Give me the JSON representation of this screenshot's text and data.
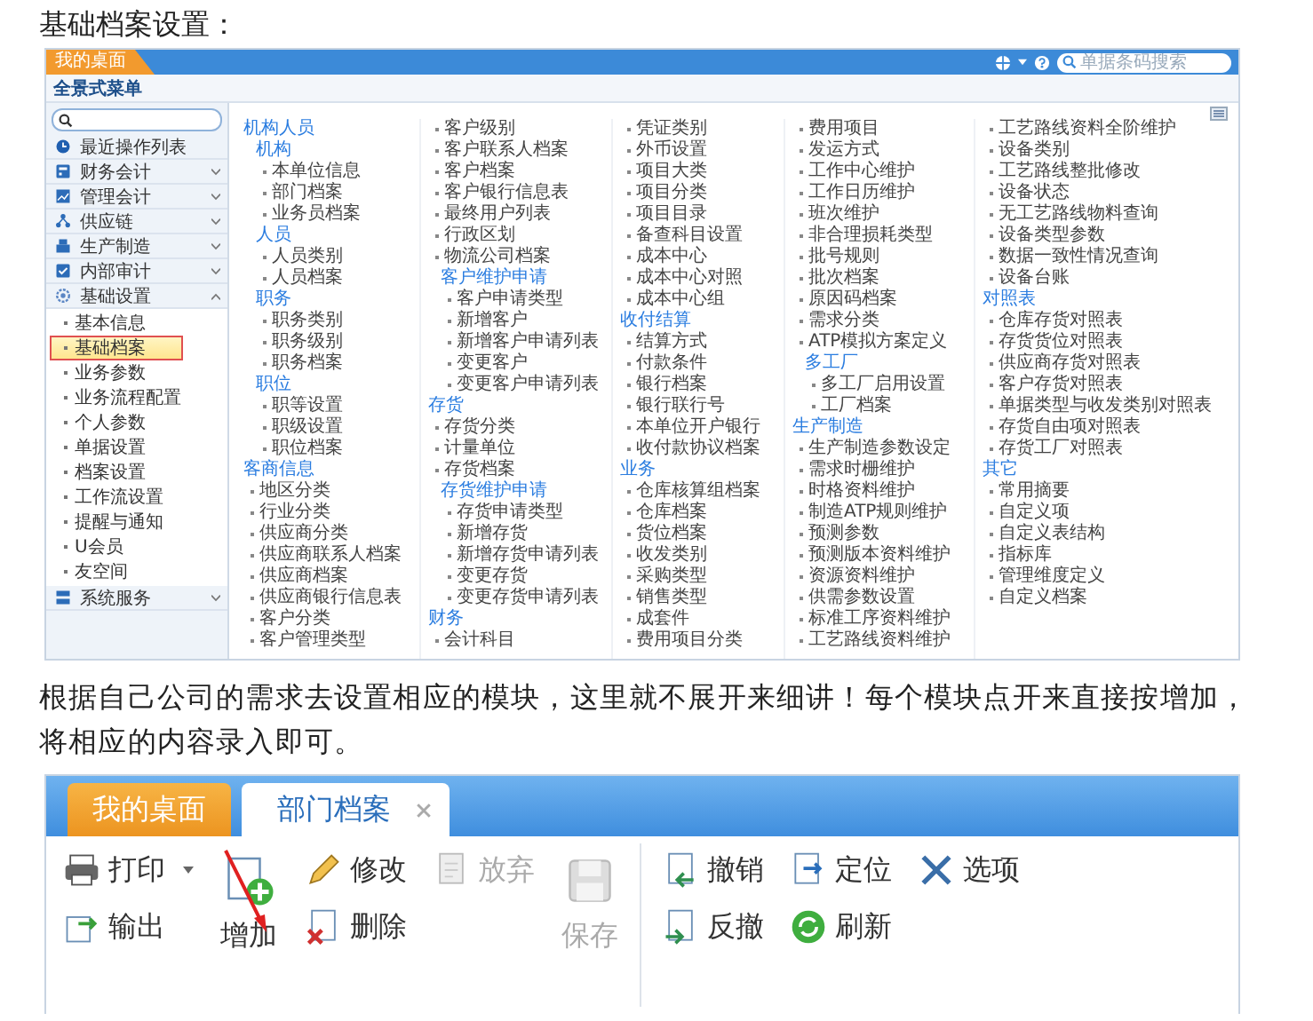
{
  "intro": "基础档案设置：",
  "app1": {
    "tab": "我的桌面",
    "search": {
      "placeholder": "单据条码搜索"
    },
    "menu_title": "全景式菜单",
    "sidebar": [
      {
        "kind": "link",
        "label": "最近操作列表"
      },
      {
        "kind": "category",
        "label": "财务会计",
        "expanded": false
      },
      {
        "kind": "category",
        "label": "管理会计",
        "expanded": false
      },
      {
        "kind": "category",
        "label": "供应链",
        "expanded": false
      },
      {
        "kind": "category",
        "label": "生产制造",
        "expanded": false
      },
      {
        "kind": "category",
        "label": "内部审计",
        "expanded": false
      },
      {
        "kind": "category",
        "label": "基础设置",
        "expanded": true,
        "children": [
          {
            "label": "基本信息",
            "selected": false
          },
          {
            "label": "基础档案",
            "selected": true
          },
          {
            "label": "业务参数",
            "selected": false
          },
          {
            "label": "业务流程配置",
            "selected": false
          },
          {
            "label": "个人参数",
            "selected": false
          },
          {
            "label": "单据设置",
            "selected": false
          },
          {
            "label": "档案设置",
            "selected": false
          },
          {
            "label": "工作流设置",
            "selected": false
          },
          {
            "label": "提醒与通知",
            "selected": false
          },
          {
            "label": "U会员",
            "selected": false
          },
          {
            "label": "友空间",
            "selected": false
          }
        ]
      },
      {
        "kind": "category",
        "label": "系统服务",
        "expanded": false
      }
    ],
    "columns": [
      [
        {
          "kind": "group",
          "label": "机构人员",
          "children": [
            {
              "kind": "subgroup",
              "label": "机构",
              "children": [
                {
                  "kind": "item",
                  "label": "本单位信息"
                },
                {
                  "kind": "item",
                  "label": "部门档案"
                },
                {
                  "kind": "item",
                  "label": "业务员档案"
                }
              ]
            },
            {
              "kind": "subgroup",
              "label": "人员",
              "children": [
                {
                  "kind": "item",
                  "label": "人员类别"
                },
                {
                  "kind": "item",
                  "label": "人员档案"
                }
              ]
            },
            {
              "kind": "subgroup",
              "label": "职务",
              "children": [
                {
                  "kind": "item",
                  "label": "职务类别"
                },
                {
                  "kind": "item",
                  "label": "职务级别"
                },
                {
                  "kind": "item",
                  "label": "职务档案"
                }
              ]
            },
            {
              "kind": "subgroup",
              "label": "职位",
              "children": [
                {
                  "kind": "item",
                  "label": "职等设置"
                },
                {
                  "kind": "item",
                  "label": "职级设置"
                },
                {
                  "kind": "item",
                  "label": "职位档案"
                }
              ]
            }
          ]
        },
        {
          "kind": "group",
          "label": "客商信息",
          "children": [
            {
              "kind": "item",
              "label": "地区分类"
            },
            {
              "kind": "item",
              "label": "行业分类"
            },
            {
              "kind": "item",
              "label": "供应商分类"
            },
            {
              "kind": "item",
              "label": "供应商联系人档案"
            },
            {
              "kind": "item",
              "label": "供应商档案"
            },
            {
              "kind": "item",
              "label": "供应商银行信息表"
            },
            {
              "kind": "item",
              "label": "客户分类"
            },
            {
              "kind": "item",
              "label": "客户管理类型"
            }
          ]
        }
      ],
      [
        {
          "kind": "group",
          "children": [
            {
              "kind": "item",
              "label": "客户级别"
            },
            {
              "kind": "item",
              "label": "客户联系人档案"
            },
            {
              "kind": "item",
              "label": "客户档案"
            },
            {
              "kind": "item",
              "label": "客户银行信息表"
            },
            {
              "kind": "item",
              "label": "最终用户列表"
            },
            {
              "kind": "item",
              "label": "行政区划"
            },
            {
              "kind": "item",
              "label": "物流公司档案"
            },
            {
              "kind": "subgroup",
              "label": "客户维护申请",
              "children": [
                {
                  "kind": "item",
                  "label": "客户申请类型"
                },
                {
                  "kind": "item",
                  "label": "新增客户"
                },
                {
                  "kind": "item",
                  "label": "新增客户申请列表"
                },
                {
                  "kind": "item",
                  "label": "变更客户"
                },
                {
                  "kind": "item",
                  "label": "变更客户申请列表"
                }
              ]
            }
          ]
        },
        {
          "kind": "group",
          "label": "存货",
          "children": [
            {
              "kind": "item",
              "label": "存货分类"
            },
            {
              "kind": "item",
              "label": "计量单位"
            },
            {
              "kind": "item",
              "label": "存货档案"
            },
            {
              "kind": "subgroup",
              "label": "存货维护申请",
              "children": [
                {
                  "kind": "item",
                  "label": "存货申请类型"
                },
                {
                  "kind": "item",
                  "label": "新增存货"
                },
                {
                  "kind": "item",
                  "label": "新增存货申请列表"
                },
                {
                  "kind": "item",
                  "label": "变更存货"
                },
                {
                  "kind": "item",
                  "label": "变更存货申请列表"
                }
              ]
            }
          ]
        },
        {
          "kind": "group",
          "label": "财务",
          "children": [
            {
              "kind": "item",
              "label": "会计科目"
            }
          ]
        }
      ],
      [
        {
          "kind": "group",
          "children": [
            {
              "kind": "item",
              "label": "凭证类别"
            },
            {
              "kind": "item",
              "label": "外币设置"
            },
            {
              "kind": "item",
              "label": "项目大类"
            },
            {
              "kind": "item",
              "label": "项目分类"
            },
            {
              "kind": "item",
              "label": "项目目录"
            },
            {
              "kind": "item",
              "label": "备查科目设置"
            },
            {
              "kind": "item",
              "label": "成本中心"
            },
            {
              "kind": "item",
              "label": "成本中心对照"
            },
            {
              "kind": "item",
              "label": "成本中心组"
            }
          ]
        },
        {
          "kind": "group",
          "label": "收付结算",
          "children": [
            {
              "kind": "item",
              "label": "结算方式"
            },
            {
              "kind": "item",
              "label": "付款条件"
            },
            {
              "kind": "item",
              "label": "银行档案"
            },
            {
              "kind": "item",
              "label": "银行联行号"
            },
            {
              "kind": "item",
              "label": "本单位开户银行"
            },
            {
              "kind": "item",
              "label": "收付款协议档案"
            }
          ]
        },
        {
          "kind": "group",
          "label": "业务",
          "children": [
            {
              "kind": "item",
              "label": "仓库核算组档案"
            },
            {
              "kind": "item",
              "label": "仓库档案"
            },
            {
              "kind": "item",
              "label": "货位档案"
            },
            {
              "kind": "item",
              "label": "收发类别"
            },
            {
              "kind": "item",
              "label": "采购类型"
            },
            {
              "kind": "item",
              "label": "销售类型"
            },
            {
              "kind": "item",
              "label": "成套件"
            },
            {
              "kind": "item",
              "label": "费用项目分类"
            }
          ]
        }
      ],
      [
        {
          "kind": "group",
          "children": [
            {
              "kind": "item",
              "label": "费用项目"
            },
            {
              "kind": "item",
              "label": "发运方式"
            },
            {
              "kind": "item",
              "label": "工作中心维护"
            },
            {
              "kind": "item",
              "label": "工作日历维护"
            },
            {
              "kind": "item",
              "label": "班次维护"
            },
            {
              "kind": "item",
              "label": "非合理损耗类型"
            },
            {
              "kind": "item",
              "label": "批号规则"
            },
            {
              "kind": "item",
              "label": "批次档案"
            },
            {
              "kind": "item",
              "label": "原因码档案"
            },
            {
              "kind": "item",
              "label": "需求分类"
            },
            {
              "kind": "item",
              "label": "ATP模拟方案定义"
            },
            {
              "kind": "subgroup",
              "label": "多工厂",
              "children": [
                {
                  "kind": "item",
                  "label": "多工厂启用设置"
                },
                {
                  "kind": "item",
                  "label": "工厂档案"
                }
              ]
            }
          ]
        },
        {
          "kind": "group",
          "label": "生产制造",
          "children": [
            {
              "kind": "item",
              "label": "生产制造参数设定"
            },
            {
              "kind": "item",
              "label": "需求时栅维护"
            },
            {
              "kind": "item",
              "label": "时格资料维护"
            },
            {
              "kind": "item",
              "label": "制造ATP规则维护"
            },
            {
              "kind": "item",
              "label": "预测参数"
            },
            {
              "kind": "item",
              "label": "预测版本资料维护"
            },
            {
              "kind": "item",
              "label": "资源资料维护"
            },
            {
              "kind": "item",
              "label": "供需参数设置"
            },
            {
              "kind": "item",
              "label": "标准工序资料维护"
            },
            {
              "kind": "item",
              "label": "工艺路线资料维护"
            }
          ]
        }
      ],
      [
        {
          "kind": "group",
          "children": [
            {
              "kind": "item",
              "label": "工艺路线资料全阶维护"
            },
            {
              "kind": "item",
              "label": "设备类别"
            },
            {
              "kind": "item",
              "label": "工艺路线整批修改"
            },
            {
              "kind": "item",
              "label": "设备状态"
            },
            {
              "kind": "item",
              "label": "无工艺路线物料查询"
            },
            {
              "kind": "item",
              "label": "设备类型参数"
            },
            {
              "kind": "item",
              "label": "数据一致性情况查询"
            },
            {
              "kind": "item",
              "label": "设备台账"
            }
          ]
        },
        {
          "kind": "group",
          "label": "对照表",
          "children": [
            {
              "kind": "item",
              "label": "仓库存货对照表"
            },
            {
              "kind": "item",
              "label": "存货货位对照表"
            },
            {
              "kind": "item",
              "label": "供应商存货对照表"
            },
            {
              "kind": "item",
              "label": "客户存货对照表"
            },
            {
              "kind": "item",
              "label": "单据类型与收发类别对照表"
            },
            {
              "kind": "item",
              "label": "存货自由项对照表"
            },
            {
              "kind": "item",
              "label": "存货工厂对照表"
            }
          ]
        },
        {
          "kind": "group",
          "label": "其它",
          "children": [
            {
              "kind": "item",
              "label": "常用摘要"
            },
            {
              "kind": "item",
              "label": "自定义项"
            },
            {
              "kind": "item",
              "label": "自定义表结构"
            },
            {
              "kind": "item",
              "label": "指标库"
            },
            {
              "kind": "item",
              "label": "管理维度定义"
            },
            {
              "kind": "item",
              "label": "自定义档案"
            }
          ]
        }
      ]
    ]
  },
  "body": "根据自己公司的需求去设置相应的模块，这里就不展开来细讲！每个模块点开来直接按增加，将相应的内容录入即可。",
  "app2": {
    "tabs": [
      {
        "label": "我的桌面",
        "selected": false
      },
      {
        "label": "部门档案",
        "selected": true
      }
    ],
    "toolbar": [
      [
        {
          "kind": "small",
          "label": "打印",
          "menu": true,
          "disabled": false
        },
        {
          "kind": "small",
          "label": "输出",
          "disabled": false
        }
      ],
      [
        {
          "kind": "large",
          "label": "增加",
          "disabled": false
        }
      ],
      [
        {
          "kind": "small",
          "label": "修改",
          "disabled": false
        },
        {
          "kind": "small",
          "label": "删除",
          "disabled": false
        }
      ],
      [
        {
          "kind": "small",
          "label": "放弃",
          "disabled": true
        }
      ],
      [
        {
          "kind": "large",
          "label": "保存",
          "disabled": true
        }
      ],
      [
        {
          "kind": "small",
          "label": "撤销",
          "disabled": false
        },
        {
          "kind": "small",
          "label": "反撤",
          "disabled": false
        }
      ],
      [
        {
          "kind": "small",
          "label": "定位",
          "disabled": false
        },
        {
          "kind": "small",
          "label": "刷新",
          "disabled": false
        }
      ],
      [
        {
          "kind": "small",
          "label": "选项",
          "disabled": false
        }
      ]
    ]
  }
}
